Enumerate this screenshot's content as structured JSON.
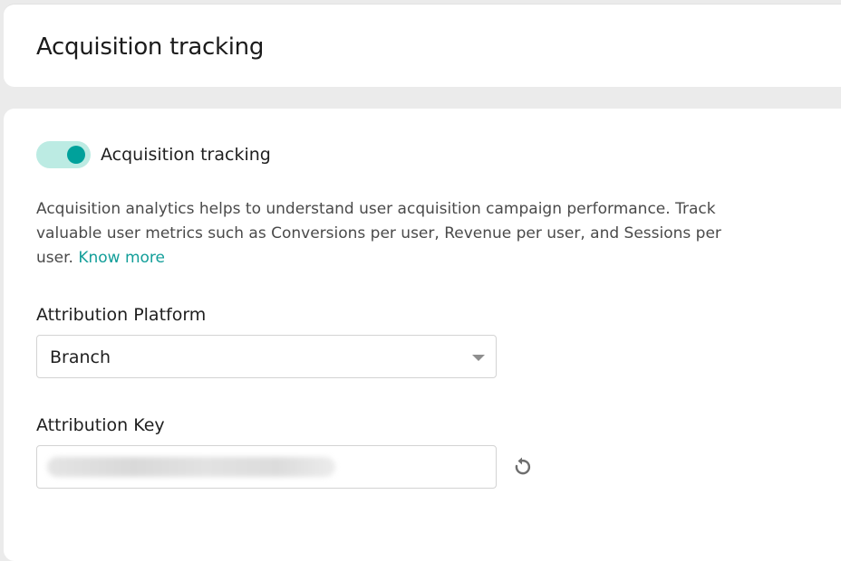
{
  "header": {
    "title": "Acquisition tracking"
  },
  "toggle": {
    "label": "Acquisition tracking",
    "enabled": true
  },
  "description": {
    "text": "Acquisition analytics helps to understand user acquisition campaign performance. Track valuable user metrics such as Conversions per user, Revenue per user, and Sessions per user. ",
    "link_label": "Know more"
  },
  "attribution_platform": {
    "label": "Attribution Platform",
    "selected": "Branch"
  },
  "attribution_key": {
    "label": "Attribution Key",
    "value": ""
  },
  "colors": {
    "accent": "#00a19b",
    "toggle_track": "#bcebe3",
    "link": "#129e99"
  },
  "icons": {
    "regenerate": "refresh-icon",
    "dropdown": "caret-down-icon"
  }
}
